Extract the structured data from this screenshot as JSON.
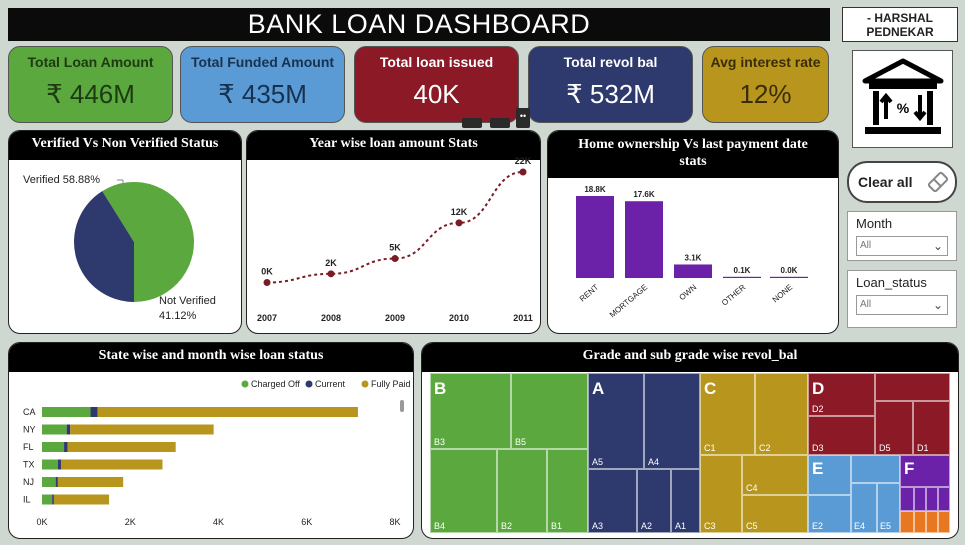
{
  "header": {
    "title": "BANK LOAN DASHBOARD",
    "author_line1": "- HARSHAL",
    "author_line2": "PEDNEKAR"
  },
  "kpis": [
    {
      "label": "Total Loan Amount",
      "value": "₹ 446M",
      "bg": "#5aa83e",
      "fg": "#1e3a12"
    },
    {
      "label": "Total Funded Amount",
      "value": "₹ 435M",
      "bg": "#5b9bd5",
      "fg": "#17324f"
    },
    {
      "label": "Total loan issued",
      "value": "40K",
      "bg": "#8b1a26",
      "fg": "#ffffff"
    },
    {
      "label": "Total revol bal",
      "value": "₹ 532M",
      "bg": "#2e3a6e",
      "fg": "#ffffff"
    },
    {
      "label": "Avg interest rate",
      "value": "12%",
      "bg": "#b8961e",
      "fg": "#3a2d06"
    }
  ],
  "controls": {
    "clear_label": "Clear all",
    "month_label": "Month",
    "month_value": "All",
    "status_label": "Loan_status",
    "status_value": "All"
  },
  "pie": {
    "title": "Verified Vs Non Verified Status",
    "verified_label": "Verified 58.88%",
    "not_verified_label1": "Not Verified",
    "not_verified_label2": "41.12%"
  },
  "line": {
    "title": "Year wise loan amount Stats"
  },
  "home": {
    "title1": "Home ownership Vs last payment date",
    "title2": "stats"
  },
  "state": {
    "title": "State wise and month wise loan status"
  },
  "treemap": {
    "title": "Grade and sub grade wise revol_bal",
    "big": [
      "B",
      "A",
      "C",
      "D",
      "E",
      "F"
    ],
    "small": [
      "B3",
      "B5",
      "B4",
      "B2",
      "B1",
      "A5",
      "A4",
      "A3",
      "A2",
      "A1",
      "C1",
      "C2",
      "C4",
      "C3",
      "C5",
      "D2",
      "D3",
      "D5",
      "D1",
      "E2",
      "E4",
      "E5"
    ]
  },
  "chart_data": [
    {
      "type": "pie",
      "title": "Verified Vs Non Verified Status",
      "categories": [
        "Verified",
        "Not Verified"
      ],
      "values": [
        58.88,
        41.12
      ],
      "colors": [
        "#5aa83e",
        "#2e3a6e"
      ]
    },
    {
      "type": "line",
      "title": "Year wise loan amount Stats",
      "x": [
        "2007",
        "2008",
        "2009",
        "2010",
        "2011"
      ],
      "values": [
        0.3,
        2,
        5,
        12,
        22
      ],
      "data_labels": [
        "0K",
        "2K",
        "5K",
        "12K",
        "22K"
      ],
      "color": "#7a1c24"
    },
    {
      "type": "bar",
      "title": "Home ownership Vs last payment date stats",
      "categories": [
        "RENT",
        "MORTGAGE",
        "OWN",
        "OTHER",
        "NONE"
      ],
      "values": [
        18.8,
        17.6,
        3.1,
        0.1,
        0.0
      ],
      "data_labels": [
        "18.8K",
        "17.6K",
        "3.1K",
        "0.1K",
        "0.0K"
      ],
      "color": "#6b21a8"
    },
    {
      "type": "bar",
      "orientation": "horizontal",
      "stacked": true,
      "title": "State wise and month wise loan status",
      "categories": [
        "CA",
        "NY",
        "FL",
        "TX",
        "NJ",
        "IL"
      ],
      "series": [
        {
          "name": "Charged Off",
          "values": [
            1100,
            560,
            500,
            360,
            310,
            230
          ],
          "color": "#5aa83e"
        },
        {
          "name": "Current",
          "values": [
            160,
            80,
            80,
            70,
            50,
            40
          ],
          "color": "#2e3a6e"
        },
        {
          "name": "Fully Paid",
          "values": [
            5900,
            3250,
            2450,
            2300,
            1480,
            1250
          ],
          "color": "#b8961e"
        }
      ],
      "xticks": [
        "0K",
        "2K",
        "4K",
        "6K",
        "8K"
      ],
      "xlim": [
        0,
        8000
      ],
      "legend": "top-right"
    }
  ]
}
